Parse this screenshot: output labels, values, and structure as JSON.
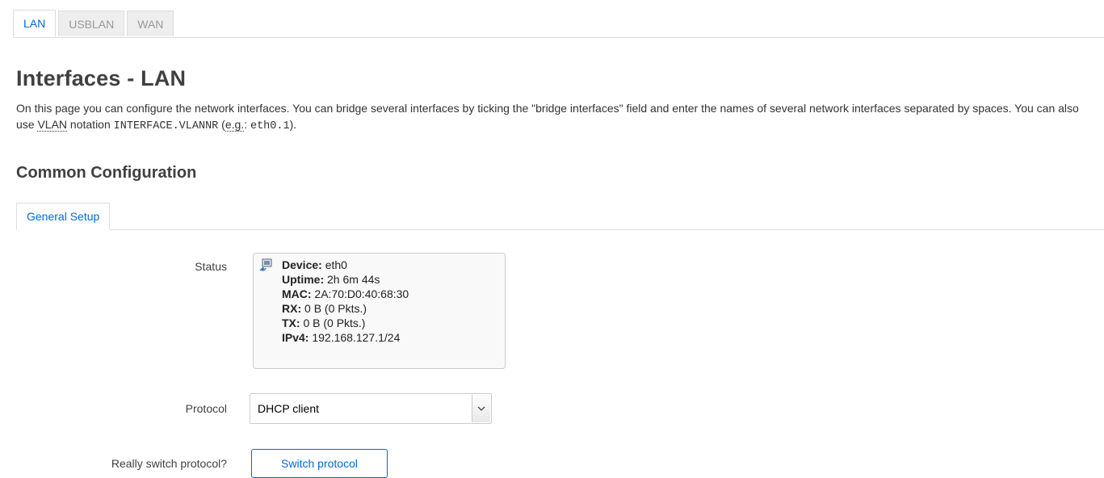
{
  "top_tabs": [
    {
      "label": "LAN",
      "active": true
    },
    {
      "label": "USBLAN",
      "active": false
    },
    {
      "label": "WAN",
      "active": false
    }
  ],
  "page_title": "Interfaces - LAN",
  "description": {
    "part1": "On this page you can configure the network interfaces. You can bridge several interfaces by ticking the \"bridge interfaces\" field and enter the names of several network interfaces separated by spaces. You can also use ",
    "vlan_abbr": "VLAN",
    "part2": " notation ",
    "code1": "INTERFACE.VLANNR",
    "part3": " (",
    "eg_abbr": "e.g.",
    "part4": ": ",
    "code2": "eth0.1",
    "part5": ")."
  },
  "section_title": "Common Configuration",
  "section_tab": "General Setup",
  "status": {
    "label": "Status",
    "icon": "ethernet-port-icon",
    "lines": [
      {
        "key": "Device:",
        "value": " eth0"
      },
      {
        "key": "Uptime:",
        "value": " 2h 6m 44s"
      },
      {
        "key": "MAC:",
        "value": " 2A:70:D0:40:68:30"
      },
      {
        "key": "RX:",
        "value": " 0 B (0 Pkts.)"
      },
      {
        "key": "TX:",
        "value": " 0 B (0 Pkts.)"
      },
      {
        "key": "IPv4:",
        "value": " 192.168.127.1/24"
      }
    ]
  },
  "protocol": {
    "label": "Protocol",
    "selected": "DHCP client"
  },
  "switch": {
    "label": "Really switch protocol?",
    "button": "Switch protocol"
  },
  "colors": {
    "accent": "#0069d6",
    "heading": "#404040"
  }
}
